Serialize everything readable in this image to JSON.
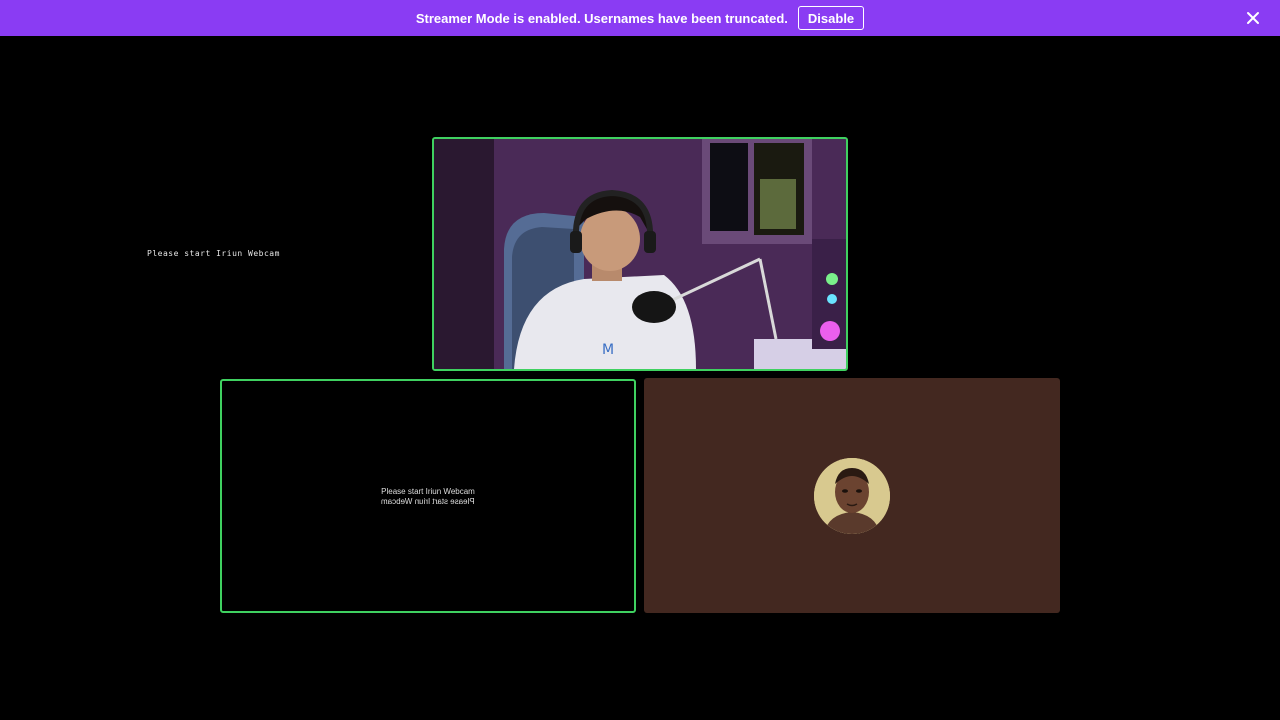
{
  "banner": {
    "message": "Streamer Mode is enabled. Usernames have been truncated.",
    "disable_label": "Disable",
    "close_icon": "close-icon",
    "color": "#8a3cf3"
  },
  "overlay": {
    "text": "Please start Iriun Webcam"
  },
  "tiles": {
    "left": {
      "line1": "Please start Iriun Webcam",
      "line2": "Please start Iriun Webcam"
    },
    "right": {
      "avatar_icon": "user-avatar"
    }
  },
  "colors": {
    "speaking_border": "#3fd160",
    "avatar_tile_bg": "#432820",
    "background": "#000000"
  }
}
